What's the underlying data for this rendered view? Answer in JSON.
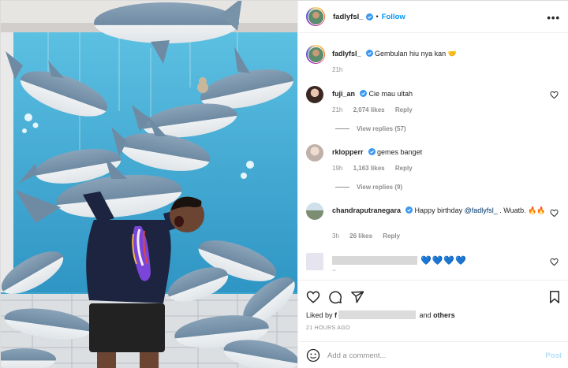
{
  "header": {
    "username": "fadlyfsl_",
    "separator": "•",
    "follow_label": "Follow",
    "more_label": "•••"
  },
  "caption": {
    "username": "fadlyfsl_",
    "text": "Gembulan hiu nya kan 🤝",
    "time": "21h"
  },
  "comments": [
    {
      "username": "fuji_an",
      "text": "Cie mau ultah",
      "time": "21h",
      "likes": "2,074 likes",
      "reply": "Reply",
      "view_replies": "View replies (57)"
    },
    {
      "username": "rklopperr",
      "text": "gemes banget",
      "time": "19h",
      "likes": "1,163 likes",
      "reply": "Reply",
      "view_replies": "View replies (9)"
    },
    {
      "username": "chandraputranegara",
      "text_before": "Happy birthday ",
      "mention": "@fadlyfsl_",
      "text_after": " . Wuatb. 🔥🔥",
      "time": "3h",
      "likes": "26 likes",
      "reply": "Reply"
    },
    {
      "hearts": "💙💙💙💙",
      "second_line": "~"
    }
  ],
  "likes": {
    "prefix": "Liked by ",
    "first_char": "f",
    "and": " and ",
    "others": "others"
  },
  "post_time": "21 HOURS AGO",
  "add_comment": {
    "placeholder": "Add a comment...",
    "post_label": "Post"
  },
  "colors": {
    "accent": "#0095f6",
    "verified": "#3897f0",
    "muted": "#8e8e8e",
    "photo_wall": "#3ea7cf"
  },
  "icons": [
    "verified-icon",
    "heart-icon",
    "comment-icon",
    "share-icon",
    "bookmark-icon",
    "emoji-icon",
    "more-icon"
  ]
}
